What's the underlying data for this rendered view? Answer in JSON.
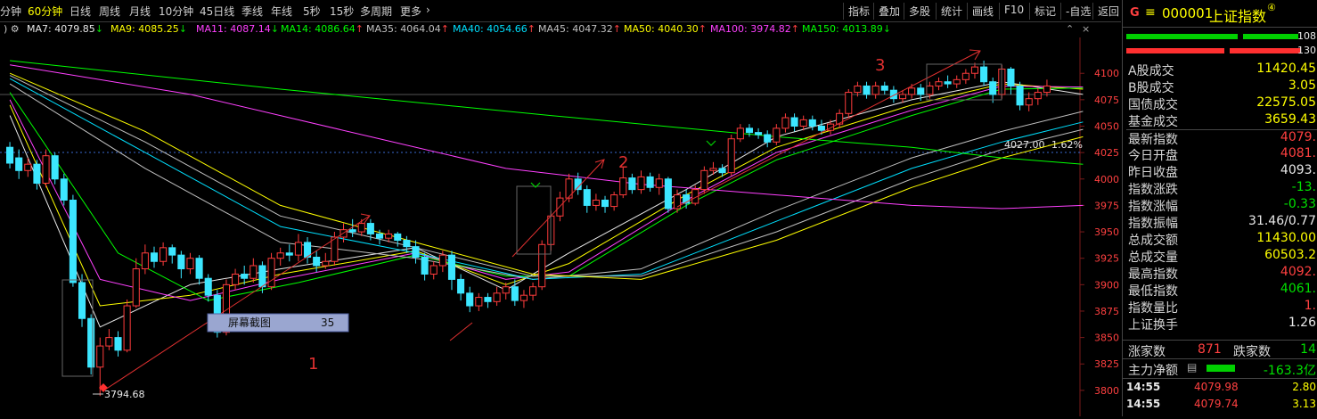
{
  "toolbar": {
    "periods": [
      "分钟",
      "60分钟",
      "日线",
      "周线",
      "月线",
      "10分钟",
      "45日线",
      "季线",
      "年线",
      "5秒",
      "15秒",
      "多周期",
      "更多"
    ],
    "active_period": "60分钟",
    "right_buttons": [
      "指标",
      "叠加",
      "多股",
      "统计",
      "画线",
      "F10",
      "标记",
      "-自选",
      "返回"
    ]
  },
  "ma_bar": {
    "items": [
      {
        "label": "MA7: 4079.85",
        "arrow": "↓",
        "color": "#e8e8e8"
      },
      {
        "label": "MA9: 4085.25",
        "arrow": "↓",
        "color": "#ffff00"
      },
      {
        "label": "MA11: 4087.14",
        "arrow": "↓",
        "color": "#ff40ff"
      },
      {
        "label": "MA14: 4086.64",
        "arrow": "↑",
        "color": "#00ff00"
      },
      {
        "label": "MA35: 4064.04",
        "arrow": "↑",
        "color": "#c0c0c0"
      },
      {
        "label": "MA40: 4054.66",
        "arrow": "↑",
        "color": "#00e0ff"
      },
      {
        "label": "MA45: 4047.32",
        "arrow": "↑",
        "color": "#c0c0c0"
      },
      {
        "label": "MA50: 4040.30",
        "arrow": "↑",
        "color": "#ffff00"
      },
      {
        "label": "MA100: 3974.82",
        "arrow": "↑",
        "color": "#ff40ff"
      },
      {
        "label": "MA150: 4013.89",
        "arrow": "↓",
        "color": "#00ff00"
      }
    ]
  },
  "chart": {
    "y_ticks": [
      "4100",
      "4075",
      "4050",
      "4025",
      "4000",
      "3975",
      "3950",
      "3925",
      "3900",
      "3875",
      "3850",
      "3825",
      "3800"
    ],
    "low_label": "3794.68",
    "ref_label": "4027.00 -1.62%",
    "annotations": [
      "1",
      "2",
      "3"
    ],
    "popup_label": "屏幕截图",
    "popup_value": "35"
  },
  "chart_data": {
    "type": "candlestick",
    "period": "60分钟",
    "ylim": [
      3794,
      4112
    ],
    "candles": [
      [
        4030,
        4015,
        4035,
        4010
      ],
      [
        4020,
        4008,
        4028,
        4000
      ],
      [
        4008,
        4014,
        4020,
        4002
      ],
      [
        4014,
        3996,
        4018,
        3990
      ],
      [
        3996,
        4022,
        4028,
        3992
      ],
      [
        4022,
        4000,
        4025,
        3995
      ],
      [
        4000,
        3980,
        4005,
        3975
      ],
      [
        3980,
        3902,
        3985,
        3898
      ],
      [
        3902,
        3868,
        3910,
        3860
      ],
      [
        3868,
        3822,
        3872,
        3815
      ],
      [
        3822,
        3842,
        3850,
        3794.68
      ],
      [
        3842,
        3850,
        3858,
        3838
      ],
      [
        3850,
        3838,
        3856,
        3832
      ],
      [
        3838,
        3880,
        3886,
        3836
      ],
      [
        3880,
        3915,
        3925,
        3878
      ],
      [
        3915,
        3930,
        3938,
        3910
      ],
      [
        3930,
        3922,
        3936,
        3916
      ],
      [
        3922,
        3935,
        3940,
        3918
      ],
      [
        3935,
        3928,
        3938,
        3920
      ],
      [
        3928,
        3915,
        3932,
        3906
      ],
      [
        3915,
        3925,
        3930,
        3910
      ],
      [
        3925,
        3906,
        3928,
        3900
      ],
      [
        3906,
        3890,
        3910,
        3884
      ],
      [
        3890,
        3855,
        3895,
        3850
      ],
      [
        3855,
        3900,
        3905,
        3852
      ],
      [
        3900,
        3910,
        3915,
        3895
      ],
      [
        3910,
        3906,
        3918,
        3900
      ],
      [
        3906,
        3918,
        3925,
        3902
      ],
      [
        3918,
        3898,
        3922,
        3892
      ],
      [
        3898,
        3925,
        3930,
        3895
      ],
      [
        3925,
        3930,
        3935,
        3918
      ],
      [
        3930,
        3928,
        3938,
        3922
      ],
      [
        3928,
        3940,
        3948,
        3922
      ],
      [
        3940,
        3926,
        3945,
        3920
      ],
      [
        3926,
        3918,
        3932,
        3912
      ],
      [
        3918,
        3922,
        3930,
        3915
      ],
      [
        3922,
        3945,
        3950,
        3918
      ],
      [
        3945,
        3952,
        3958,
        3940
      ],
      [
        3952,
        3950,
        3962,
        3945
      ],
      [
        3950,
        3958,
        3962,
        3946
      ],
      [
        3958,
        3948,
        3962,
        3942
      ],
      [
        3948,
        3944,
        3952,
        3938
      ],
      [
        3944,
        3948,
        3952,
        3940
      ],
      [
        3948,
        3942,
        3950,
        3936
      ],
      [
        3942,
        3936,
        3946,
        3930
      ],
      [
        3936,
        3926,
        3942,
        3920
      ],
      [
        3926,
        3910,
        3930,
        3904
      ],
      [
        3910,
        3918,
        3922,
        3905
      ],
      [
        3918,
        3928,
        3932,
        3912
      ],
      [
        3928,
        3905,
        3932,
        3895
      ],
      [
        3905,
        3892,
        3910,
        3885
      ],
      [
        3892,
        3880,
        3898,
        3874
      ],
      [
        3880,
        3888,
        3892,
        3875
      ],
      [
        3888,
        3884,
        3892,
        3878
      ],
      [
        3884,
        3892,
        3898,
        3880
      ],
      [
        3892,
        3898,
        3902,
        3886
      ],
      [
        3898,
        3885,
        3905,
        3880
      ],
      [
        3885,
        3890,
        3895,
        3878
      ],
      [
        3890,
        3898,
        3902,
        3885
      ],
      [
        3898,
        3938,
        3942,
        3895
      ],
      [
        3938,
        3965,
        3970,
        3932
      ],
      [
        3965,
        3982,
        3988,
        3960
      ],
      [
        3982,
        4000,
        4005,
        3978
      ],
      [
        4000,
        3990,
        4006,
        3985
      ],
      [
        3990,
        3975,
        3994,
        3968
      ],
      [
        3975,
        3980,
        3986,
        3970
      ],
      [
        3980,
        3974,
        3984,
        3968
      ],
      [
        3974,
        3985,
        3988,
        3970
      ],
      [
        3985,
        4001,
        4012,
        3982
      ],
      [
        4001,
        3990,
        4005,
        3986
      ],
      [
        3990,
        4002,
        4008,
        3986
      ],
      [
        4002,
        3992,
        4006,
        3988
      ],
      [
        3992,
        4000,
        4005,
        3985
      ],
      [
        4000,
        3972,
        4002,
        3968
      ],
      [
        3972,
        3985,
        3990,
        3968
      ],
      [
        3985,
        3977,
        3990,
        3972
      ],
      [
        3977,
        3990,
        3994,
        3975
      ],
      [
        3990,
        4008,
        4012,
        3986
      ],
      [
        4008,
        4010,
        4016,
        4004
      ],
      [
        4010,
        4006,
        4014,
        4002
      ],
      [
        4006,
        4038,
        4042,
        4003
      ],
      [
        4038,
        4048,
        4052,
        4035
      ],
      [
        4048,
        4044,
        4052,
        4040
      ],
      [
        4044,
        4042,
        4048,
        4038
      ],
      [
        4042,
        4035,
        4046,
        4030
      ],
      [
        4035,
        4048,
        4052,
        4032
      ],
      [
        4048,
        4058,
        4062,
        4044
      ],
      [
        4058,
        4050,
        4062,
        4045
      ],
      [
        4050,
        4056,
        4060,
        4046
      ],
      [
        4056,
        4050,
        4060,
        4046
      ],
      [
        4050,
        4046,
        4056,
        4042
      ],
      [
        4046,
        4052,
        4056,
        4042
      ],
      [
        4052,
        4062,
        4066,
        4048
      ],
      [
        4062,
        4082,
        4085,
        4058
      ],
      [
        4082,
        4088,
        4092,
        4078
      ],
      [
        4088,
        4080,
        4092,
        4076
      ],
      [
        4080,
        4088,
        4092,
        4076
      ],
      [
        4088,
        4084,
        4092,
        4080
      ],
      [
        4084,
        4076,
        4088,
        4072
      ],
      [
        4076,
        4080,
        4084,
        4072
      ],
      [
        4080,
        4086,
        4090,
        4076
      ],
      [
        4086,
        4080,
        4090,
        4074
      ],
      [
        4080,
        4088,
        4092,
        4076
      ],
      [
        4088,
        4092,
        4096,
        4084
      ],
      [
        4092,
        4090,
        4098,
        4086
      ],
      [
        4090,
        4094,
        4098,
        4086
      ],
      [
        4094,
        4100,
        4104,
        4090
      ],
      [
        4100,
        4106,
        4110,
        4095
      ],
      [
        4106,
        4092,
        4112,
        4088
      ],
      [
        4092,
        4080,
        4096,
        4072
      ],
      [
        4080,
        4104,
        4108,
        4076
      ],
      [
        4104,
        4088,
        4106,
        4080
      ],
      [
        4088,
        4070,
        4092,
        4065
      ],
      [
        4070,
        4076,
        4082,
        4064
      ],
      [
        4076,
        4082,
        4086,
        4070
      ],
      [
        4082,
        4088,
        4094,
        4078
      ]
    ],
    "ma_series": [
      {
        "name": "MA7",
        "color": "#e8e8e8",
        "points": [
          [
            0,
            4060
          ],
          [
            10,
            3860
          ],
          [
            20,
            3900
          ],
          [
            30,
            3915
          ],
          [
            45,
            3935
          ],
          [
            55,
            3895
          ],
          [
            62,
            3930
          ],
          [
            75,
            3990
          ],
          [
            85,
            4040
          ],
          [
            100,
            4075
          ],
          [
            110,
            4092
          ],
          [
            119,
            4080
          ]
        ]
      },
      {
        "name": "MA9",
        "color": "#ffff00",
        "points": [
          [
            0,
            4070
          ],
          [
            10,
            3880
          ],
          [
            20,
            3890
          ],
          [
            30,
            3910
          ],
          [
            45,
            3932
          ],
          [
            55,
            3900
          ],
          [
            62,
            3920
          ],
          [
            75,
            3985
          ],
          [
            85,
            4030
          ],
          [
            100,
            4070
          ],
          [
            110,
            4090
          ],
          [
            119,
            4085
          ]
        ]
      },
      {
        "name": "MA11",
        "color": "#ff40ff",
        "points": [
          [
            0,
            4075
          ],
          [
            10,
            3905
          ],
          [
            20,
            3885
          ],
          [
            30,
            3905
          ],
          [
            45,
            3930
          ],
          [
            55,
            3905
          ],
          [
            62,
            3912
          ],
          [
            75,
            3980
          ],
          [
            85,
            4025
          ],
          [
            100,
            4065
          ],
          [
            110,
            4088
          ],
          [
            119,
            4087
          ]
        ]
      },
      {
        "name": "MA14",
        "color": "#00ff00",
        "points": [
          [
            0,
            4082
          ],
          [
            12,
            3930
          ],
          [
            22,
            3885
          ],
          [
            32,
            3902
          ],
          [
            45,
            3928
          ],
          [
            55,
            3908
          ],
          [
            62,
            3908
          ],
          [
            75,
            3975
          ],
          [
            85,
            4018
          ],
          [
            100,
            4060
          ],
          [
            110,
            4085
          ],
          [
            119,
            4086
          ]
        ]
      },
      {
        "name": "MA35",
        "color": "#c0c0c0",
        "points": [
          [
            0,
            4090
          ],
          [
            15,
            4010
          ],
          [
            30,
            3940
          ],
          [
            45,
            3925
          ],
          [
            58,
            3905
          ],
          [
            70,
            3915
          ],
          [
            85,
            3970
          ],
          [
            100,
            4020
          ],
          [
            110,
            4045
          ],
          [
            119,
            4064
          ]
        ]
      },
      {
        "name": "MA40",
        "color": "#00e0ff",
        "points": [
          [
            0,
            4095
          ],
          [
            15,
            4025
          ],
          [
            30,
            3955
          ],
          [
            45,
            3930
          ],
          [
            58,
            3905
          ],
          [
            70,
            3910
          ],
          [
            85,
            3960
          ],
          [
            100,
            4010
          ],
          [
            110,
            4035
          ],
          [
            119,
            4054
          ]
        ]
      },
      {
        "name": "MA45",
        "color": "#c0c0c0",
        "points": [
          [
            0,
            4098
          ],
          [
            15,
            4035
          ],
          [
            30,
            3965
          ],
          [
            45,
            3935
          ],
          [
            58,
            3908
          ],
          [
            70,
            3908
          ],
          [
            85,
            3950
          ],
          [
            100,
            4000
          ],
          [
            110,
            4028
          ],
          [
            119,
            4047
          ]
        ]
      },
      {
        "name": "MA50",
        "color": "#ffff00",
        "points": [
          [
            0,
            4100
          ],
          [
            15,
            4045
          ],
          [
            30,
            3975
          ],
          [
            45,
            3940
          ],
          [
            58,
            3910
          ],
          [
            70,
            3905
          ],
          [
            85,
            3942
          ],
          [
            100,
            3992
          ],
          [
            110,
            4020
          ],
          [
            119,
            4040
          ]
        ]
      },
      {
        "name": "MA100",
        "color": "#ff40ff",
        "points": [
          [
            0,
            4108
          ],
          [
            20,
            4080
          ],
          [
            40,
            4040
          ],
          [
            55,
            4010
          ],
          [
            70,
            3995
          ],
          [
            85,
            3985
          ],
          [
            100,
            3975
          ],
          [
            110,
            3972
          ],
          [
            119,
            3975
          ]
        ]
      },
      {
        "name": "MA150",
        "color": "#00ff00",
        "points": [
          [
            0,
            4112
          ],
          [
            30,
            4085
          ],
          [
            60,
            4060
          ],
          [
            85,
            4040
          ],
          [
            100,
            4030
          ],
          [
            110,
            4020
          ],
          [
            119,
            4014
          ]
        ]
      }
    ]
  },
  "right_panel": {
    "code_flag": "G",
    "menu_icon": "≡",
    "code": "000001",
    "name": "上证指数",
    "superscript": "④",
    "bar_value_1": "108",
    "bar_value_2": "130",
    "rows": [
      {
        "label": "A股成交",
        "value": "11420.45",
        "color": "#ffff00"
      },
      {
        "label": "B股成交",
        "value": "3.05",
        "color": "#ffff00"
      },
      {
        "label": "国债成交",
        "value": "22575.05",
        "color": "#ffff00"
      },
      {
        "label": "基金成交",
        "value": "3659.43",
        "color": "#ffff00"
      },
      {
        "label": "最新指数",
        "value": "4079.",
        "color": "#ff4040"
      },
      {
        "label": "今日开盘",
        "value": "4081.",
        "color": "#ff4040"
      },
      {
        "label": "昨日收盘",
        "value": "4093.",
        "color": "#e8e8e8"
      },
      {
        "label": "指数涨跌",
        "value": "-13.",
        "color": "#00e000"
      },
      {
        "label": "指数涨幅",
        "value": "-0.33",
        "color": "#00e000"
      },
      {
        "label": "指数振幅",
        "value": "31.46/0.77",
        "color": "#e8e8e8"
      },
      {
        "label": "总成交额",
        "value": "11430.00",
        "color": "#ffff00"
      },
      {
        "label": "总成交量",
        "value": "60503.2",
        "color": "#ffff00"
      },
      {
        "label": "最高指数",
        "value": "4092.",
        "color": "#ff4040"
      },
      {
        "label": "最低指数",
        "value": "4061.",
        "color": "#00e000"
      },
      {
        "label": "指数量比",
        "value": "1.",
        "color": "#ff4040"
      },
      {
        "label": "上证换手",
        "value": "1.26",
        "color": "#e8e8e8"
      }
    ],
    "up_label": "涨家数",
    "up_value": "871",
    "down_label": "跌家数",
    "down_value": "14",
    "net_label": "主力净额",
    "net_value": "-163.3亿",
    "ticks": [
      {
        "time": "14:55",
        "price": "4079.98",
        "vol": "2.80"
      },
      {
        "time": "14:55",
        "price": "4079.74",
        "vol": "3.13"
      }
    ]
  }
}
